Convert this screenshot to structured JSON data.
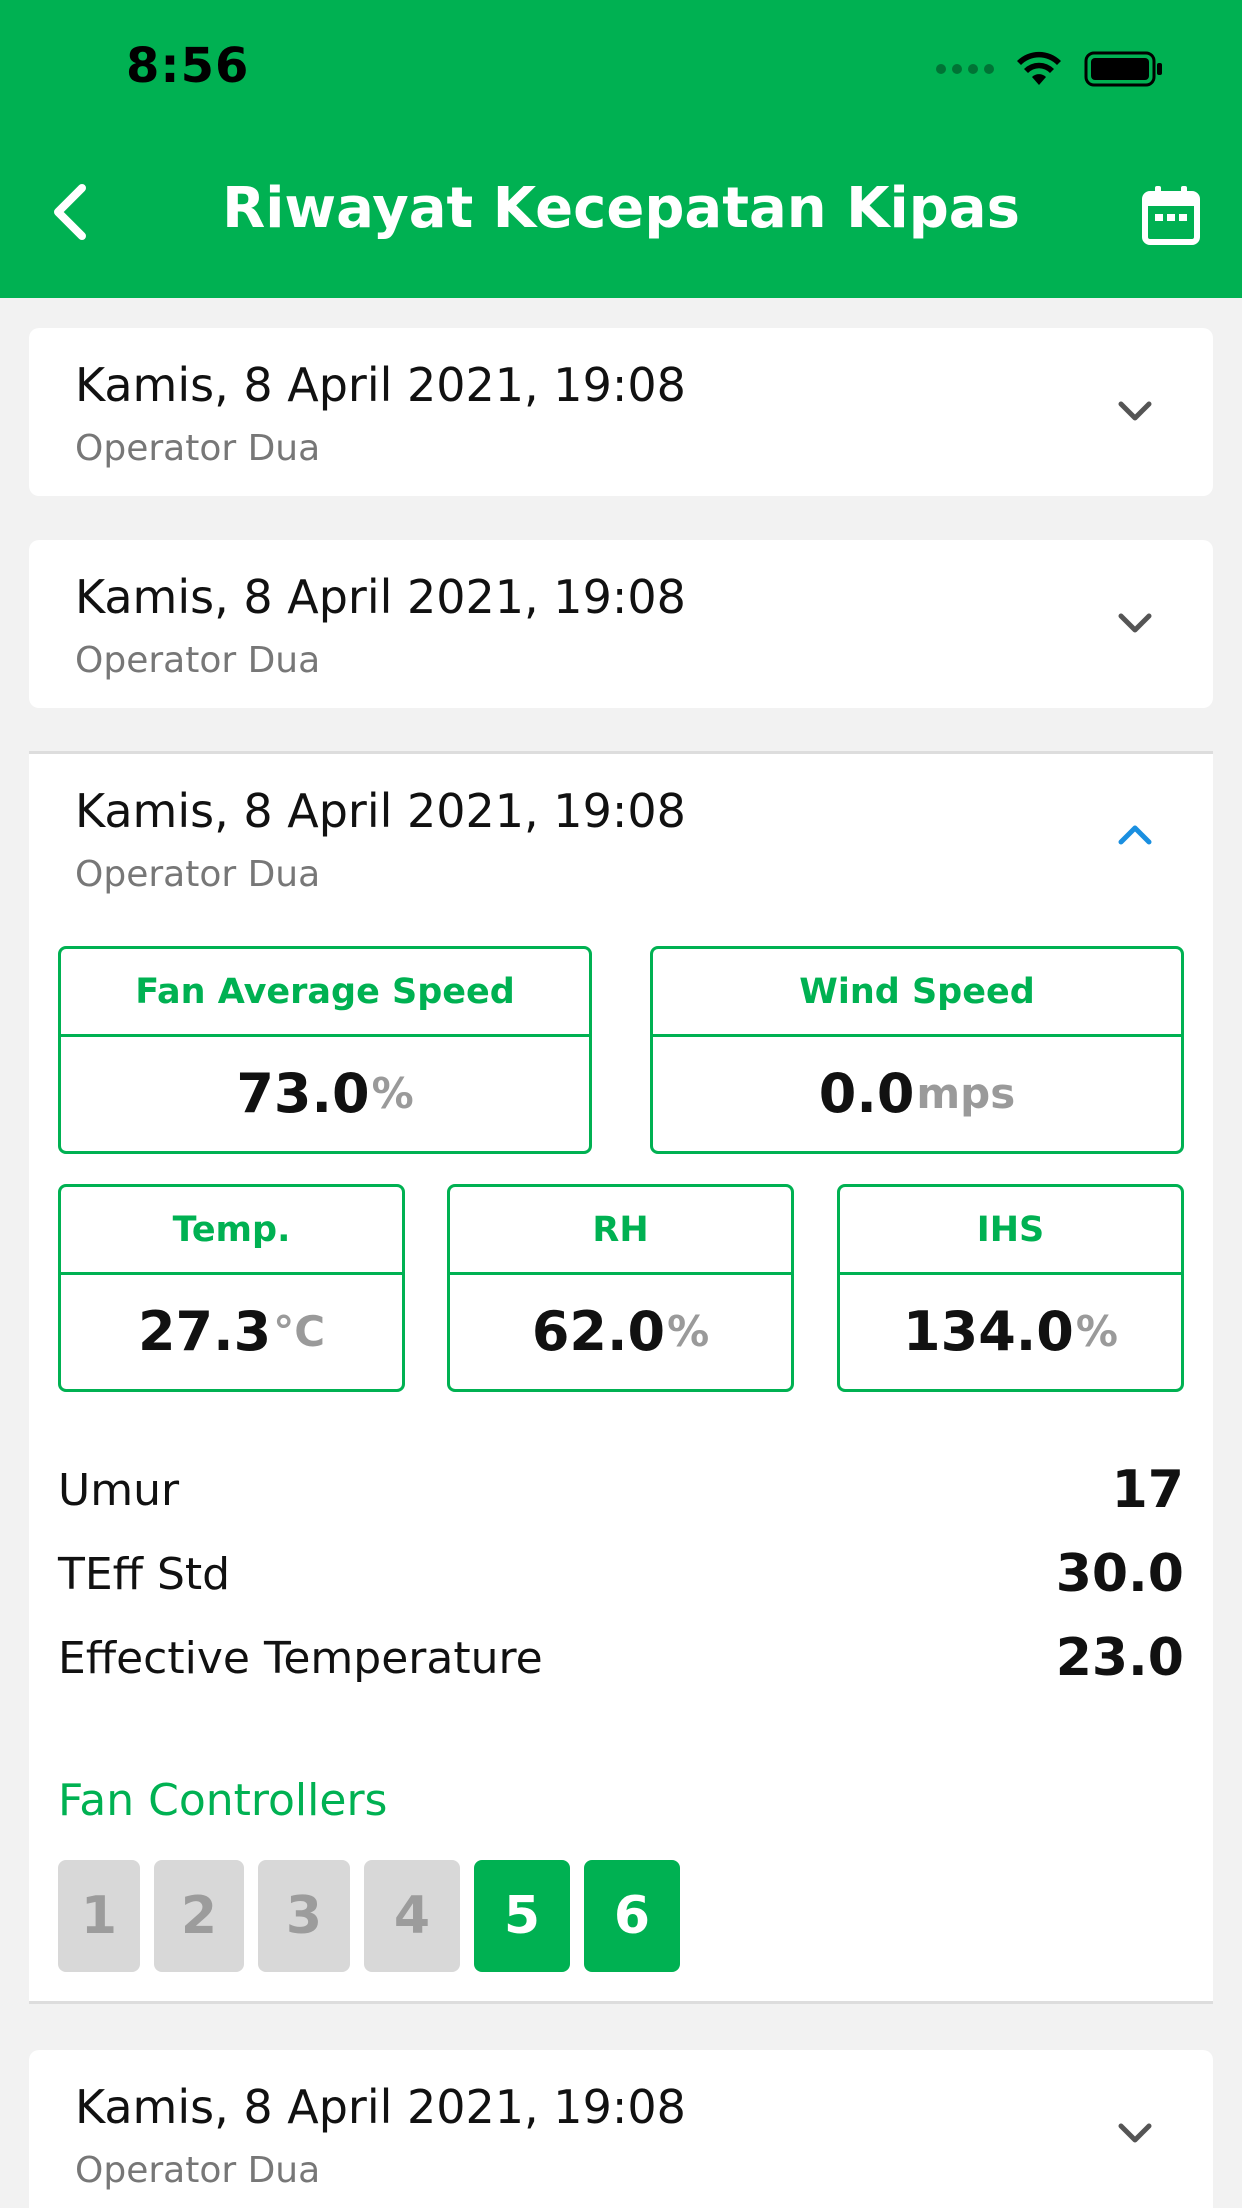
{
  "status_bar": {
    "time": "8:56"
  },
  "header": {
    "title": "Riwayat Kecepatan Kipas"
  },
  "records": [
    {
      "date": "Kamis, 8 April 2021, 19:08",
      "operator": "Operator Dua",
      "expanded": false
    },
    {
      "date": "Kamis, 8 April 2021, 19:08",
      "operator": "Operator Dua",
      "expanded": false
    },
    {
      "date": "Kamis, 8 April 2021, 19:08",
      "operator": "Operator Dua",
      "expanded": true
    },
    {
      "date": "Kamis, 8 April 2021, 19:08",
      "operator": "Operator Dua",
      "expanded": false
    }
  ],
  "details": {
    "fan_average_speed": {
      "label": "Fan Average Speed",
      "value": "73.0",
      "unit": "%"
    },
    "wind_speed": {
      "label": "Wind Speed",
      "value": "0.0",
      "unit": "mps"
    },
    "temp": {
      "label": "Temp.",
      "value": "27.3",
      "unit": "°C"
    },
    "rh": {
      "label": "RH",
      "value": "62.0",
      "unit": "%"
    },
    "ihs": {
      "label": "IHS",
      "value": "134.0",
      "unit": "%"
    },
    "umur": {
      "label": "Umur",
      "value": "17"
    },
    "teff_std": {
      "label": "TEff Std",
      "value": "30.0"
    },
    "effective_temperature": {
      "label": "Effective Temperature",
      "value": "23.0"
    },
    "fan_controllers": {
      "label": "Fan Controllers",
      "items": [
        {
          "label": "1",
          "active": false
        },
        {
          "label": "2",
          "active": false
        },
        {
          "label": "3",
          "active": false
        },
        {
          "label": "4",
          "active": false
        },
        {
          "label": "5",
          "active": true
        },
        {
          "label": "6",
          "active": true
        }
      ]
    }
  },
  "colors": {
    "primary": "#00b152",
    "accent_chevron": "#1a8fe0",
    "inactive": "#d8d8d8"
  }
}
